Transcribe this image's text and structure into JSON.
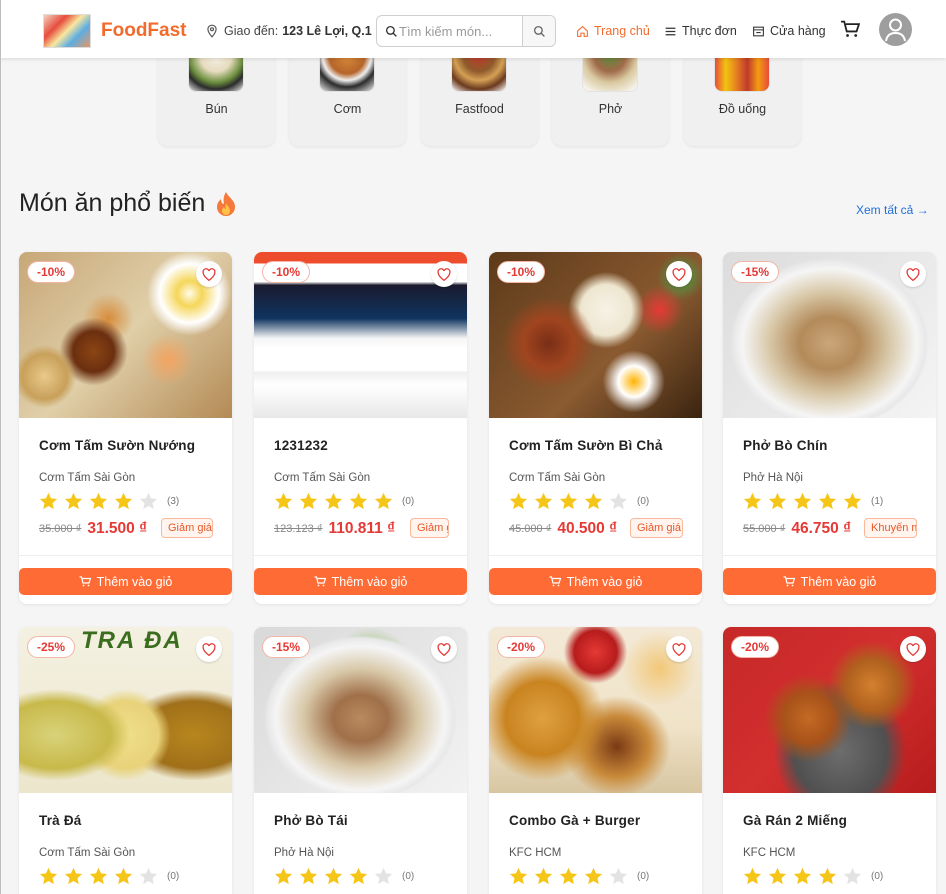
{
  "header": {
    "brand": "FoodFast",
    "location_label": "Giao đến:",
    "location_value": "123 Lê Lợi, Q.1",
    "search_placeholder": "Tìm kiếm món...",
    "nav": [
      {
        "label": "Trang chủ",
        "icon": "home-icon",
        "active": true
      },
      {
        "label": "Thực đơn",
        "icon": "menu-icon",
        "active": false
      },
      {
        "label": "Cửa hàng",
        "icon": "store-icon",
        "active": false
      }
    ],
    "accent_color": "#f26b2d"
  },
  "categories": [
    {
      "label": "Bún"
    },
    {
      "label": "Cơm"
    },
    {
      "label": "Fastfood"
    },
    {
      "label": "Phở"
    },
    {
      "label": "Đồ uống"
    }
  ],
  "section": {
    "title": "Món ăn phổ biến",
    "see_all": "Xem tất cả →"
  },
  "products": [
    {
      "discount": "-10%",
      "name": "Cơm Tấm Sườn Nướng",
      "shop": "Cơm Tấm Sài Gòn",
      "rating": 4,
      "reviews": "(3)",
      "old_price": "35.000 ₫",
      "price": "31.500 ₫",
      "promo": "Giảm giá m",
      "button": "Thêm vào giỏ"
    },
    {
      "discount": "-10%",
      "name": "1231232",
      "shop": "Cơm Tấm Sài Gòn",
      "rating": 5,
      "reviews": "(0)",
      "old_price": "123.123 ₫",
      "price": "110.811 ₫",
      "promo": "Giảm g",
      "button": "Thêm vào giỏ"
    },
    {
      "discount": "-10%",
      "name": "Cơm Tấm Sườn Bì Chả",
      "shop": "Cơm Tấm Sài Gòn",
      "rating": 4,
      "reviews": "(0)",
      "old_price": "45.000 ₫",
      "price": "40.500 ₫",
      "promo": "Giảm giá n",
      "button": "Thêm vào giỏ"
    },
    {
      "discount": "-15%",
      "name": "Phở Bò Chín",
      "shop": "Phở Hà Nội",
      "rating": 5,
      "reviews": "(1)",
      "old_price": "55.000 ₫",
      "price": "46.750 ₫",
      "promo": "Khuyến m",
      "button": "Thêm vào giỏ"
    },
    {
      "discount": "-25%",
      "name": "Trà Đá",
      "shop": "Cơm Tấm Sài Gòn",
      "rating": 4,
      "reviews": "(0)",
      "image_text": "TRA ĐA"
    },
    {
      "discount": "-15%",
      "name": "Phở Bò Tái",
      "shop": "Phở Hà Nội",
      "rating": 4,
      "reviews": "(0)"
    },
    {
      "discount": "-20%",
      "name": "Combo Gà + Burger",
      "shop": "KFC HCM",
      "rating": 4,
      "reviews": "(0)"
    },
    {
      "discount": "-20%",
      "name": "Gà Rán 2 Miếng",
      "shop": "KFC HCM",
      "rating": 4,
      "reviews": "(0)"
    }
  ]
}
